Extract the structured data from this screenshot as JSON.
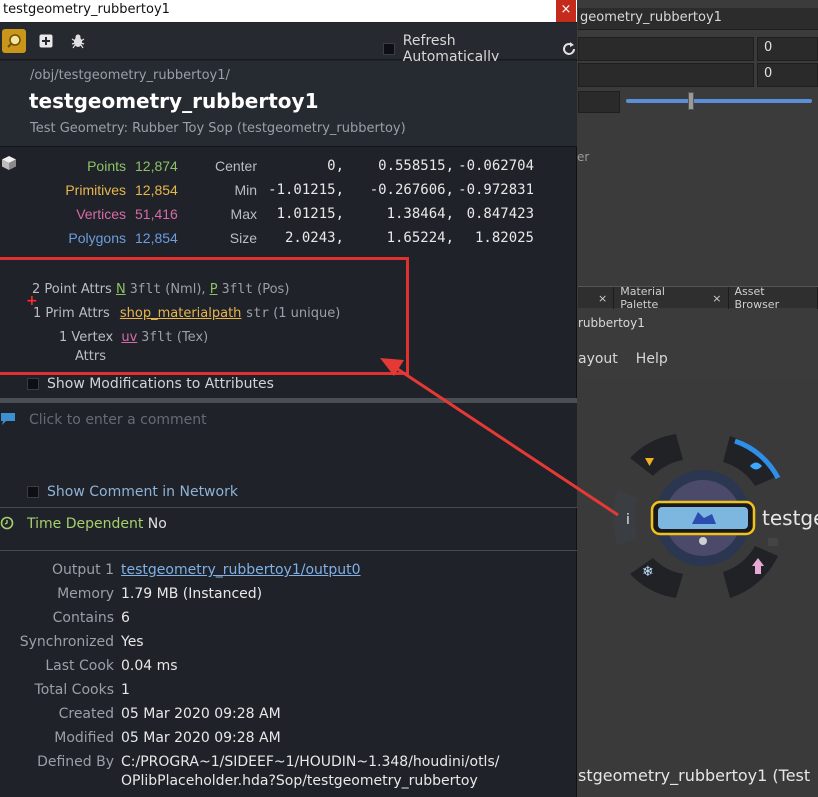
{
  "window": {
    "title": "testgeometry_rubbertoy1",
    "close": "×"
  },
  "toolbar": {
    "refresh_label": "Refresh Automatically"
  },
  "header": {
    "path": "/obj/testgeometry_rubbertoy1/",
    "name": "testgeometry_rubbertoy1",
    "description": "Test Geometry: Rubber Toy Sop (testgeometry_rubbertoy)"
  },
  "counts": [
    {
      "label": "Points",
      "value": "12,874",
      "color": "#8cc265"
    },
    {
      "label": "Primitives",
      "value": "12,854",
      "color": "#e8b64c"
    },
    {
      "label": "Vertices",
      "value": "51,416",
      "color": "#d76ba8"
    },
    {
      "label": "Polygons",
      "value": "12,854",
      "color": "#6c9de0"
    }
  ],
  "bounds": [
    {
      "label": "Center",
      "x": "0,",
      "y": "0.558515,",
      "z": "-0.062704"
    },
    {
      "label": "Min",
      "x": "-1.01215,",
      "y": "-0.267606,",
      "z": "-0.972831"
    },
    {
      "label": "Max",
      "x": "1.01215,",
      "y": "1.38464,",
      "z": "0.847423"
    },
    {
      "label": "Size",
      "x": "2.0243,",
      "y": "1.65224,",
      "z": "1.82025"
    }
  ],
  "attrs": {
    "point": {
      "count_label": "2 Point Attrs",
      "a1": "N",
      "a1_type": "3flt",
      "a1_tag": "(Nml)",
      "sep": ",",
      "a2": "P",
      "a2_type": "3flt",
      "a2_tag": "(Pos)"
    },
    "prim": {
      "count_label": "1 Prim Attrs",
      "a1": "shop_materialpath",
      "a1_type": "str",
      "a1_tag": "(1 unique)"
    },
    "vertex": {
      "count_label_1": "1 Vertex",
      "count_label_2": "Attrs",
      "a1": "uv",
      "a1_type": "3flt",
      "a1_tag": "(Tex)"
    }
  },
  "show_modifications": "Show Modifications to Attributes",
  "comment_placeholder": "Click to enter a comment",
  "show_comment": "Show Comment in Network",
  "time_dependent": {
    "label": "Time Dependent",
    "value": "No"
  },
  "details": [
    {
      "key": "Output 1",
      "value": "testgeometry_rubbertoy1/output0",
      "link": true
    },
    {
      "key": "Memory",
      "value": "1.79 MB (Instanced)"
    },
    {
      "key": "Contains",
      "value": "6"
    },
    {
      "key": "Synchronized",
      "value": "Yes"
    },
    {
      "key": "Last Cook",
      "value": "0.04 ms"
    },
    {
      "key": "Total Cooks",
      "value": "1"
    },
    {
      "key": "Created",
      "value": "05 Mar 2020 09:28 AM"
    },
    {
      "key": "Modified",
      "value": "05 Mar 2020 09:28 AM"
    },
    {
      "key": "Defined By",
      "value": "C:/PROGRA~1/SIDEEF~1/HOUDIN~1.348/houdini/otls/",
      "value2": "OPlibPlaceholder.hda?Sop/testgeometry_rubbertoy"
    }
  ],
  "background": {
    "title": "geometry_rubbertoy1",
    "field1": "0",
    "field2": "0",
    "er_text": "er",
    "tabs": [
      "Material Palette",
      "Asset Browser"
    ],
    "tab_close": "×",
    "path": "rubbertoy1",
    "menu": [
      "ayout",
      "Help"
    ],
    "node_label": "testge",
    "bottom_text": "stgeometry_rubbertoy1 (Test"
  }
}
